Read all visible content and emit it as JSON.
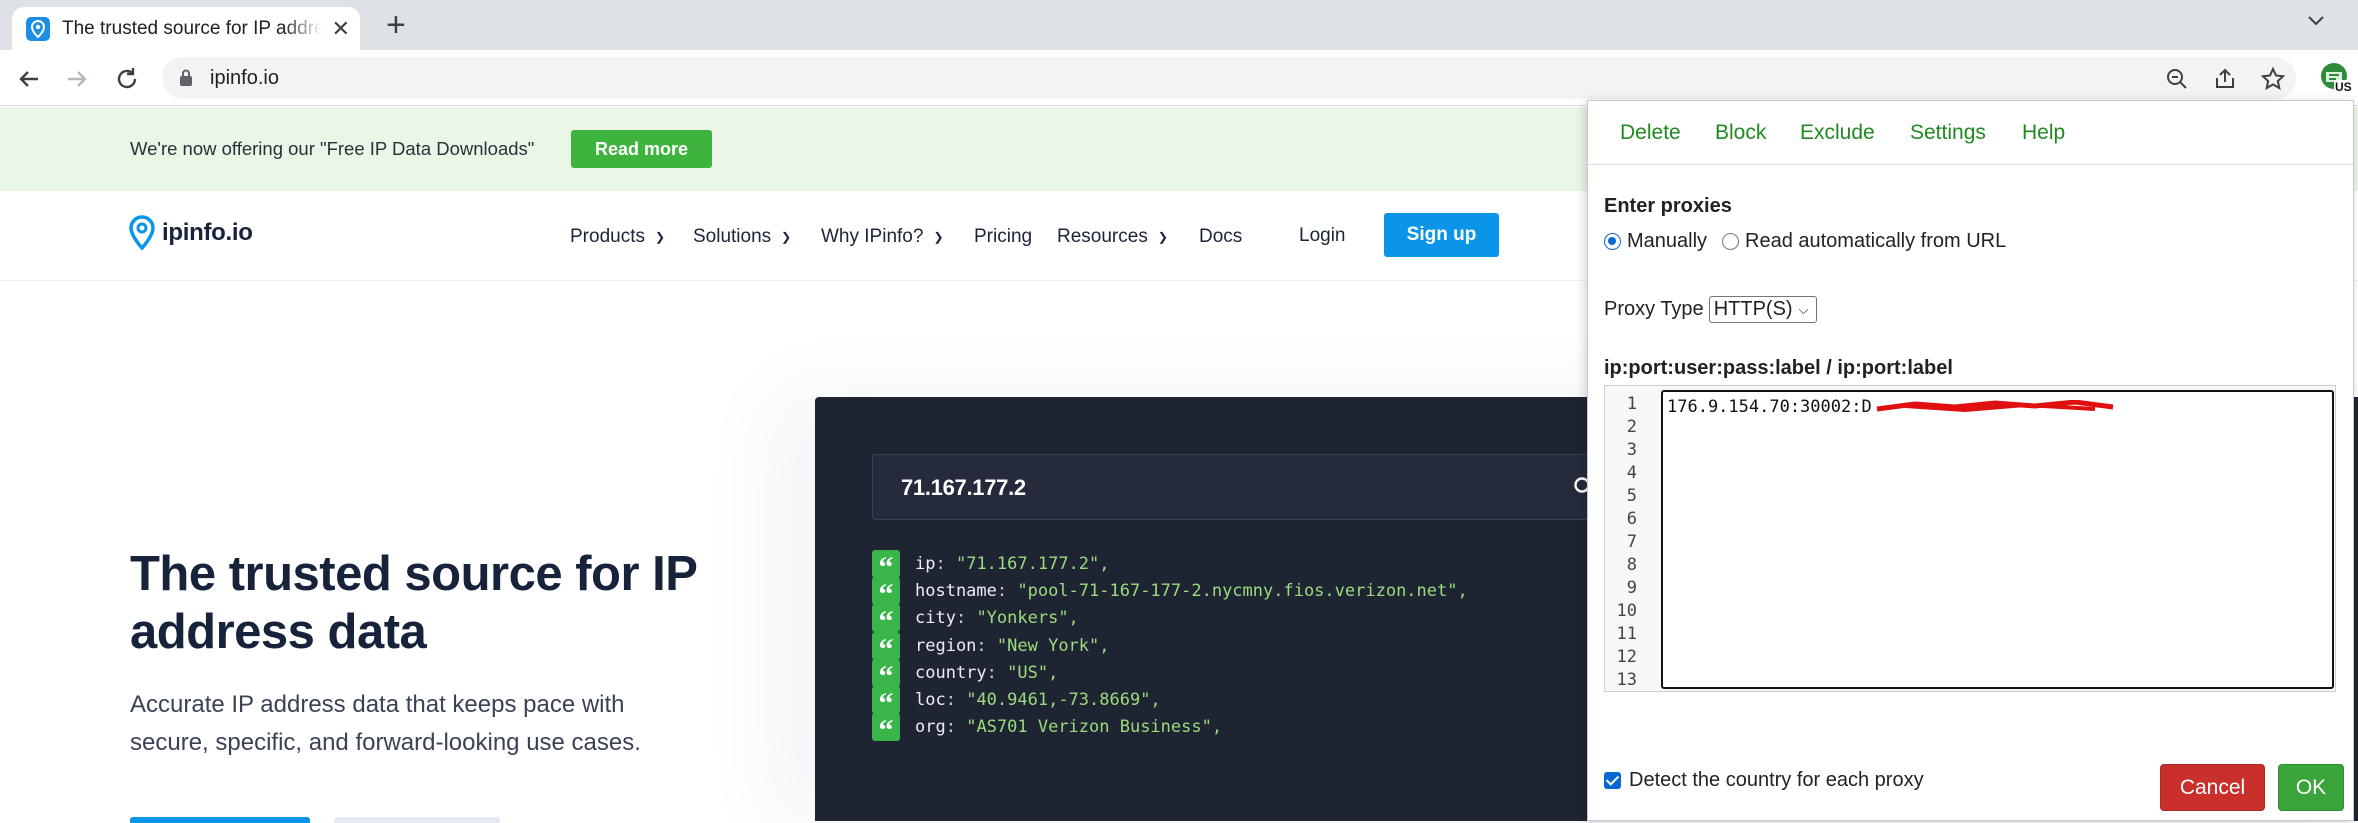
{
  "browser": {
    "tab_title": "The trusted source for IP address data",
    "tab_close": "✕",
    "new_tab": "+",
    "url": "ipinfo.io",
    "extension_badge": "US"
  },
  "banner": {
    "text": "We're now offering our \"Free IP Data Downloads\"",
    "button": "Read more"
  },
  "nav": {
    "logo": "ipinfo.io",
    "items": [
      {
        "label": "Products",
        "has_dropdown": true
      },
      {
        "label": "Solutions",
        "has_dropdown": true
      },
      {
        "label": "Why IPinfo?",
        "has_dropdown": true
      },
      {
        "label": "Pricing",
        "has_dropdown": false
      },
      {
        "label": "Resources",
        "has_dropdown": true
      },
      {
        "label": "Docs",
        "has_dropdown": false
      }
    ],
    "login": "Login",
    "signup": "Sign up"
  },
  "hero": {
    "title": "The trusted source for IP address data",
    "subtitle": "Accurate IP address data that keeps pace with secure, specific, and forward-looking use cases."
  },
  "lookup": {
    "ip": "71.167.177.2",
    "rows": [
      {
        "key": "ip",
        "value": "\"71.167.177.2\","
      },
      {
        "key": "hostname",
        "value": "\"pool-71-167-177-2.nycmny.fios.verizon.net\","
      },
      {
        "key": "city",
        "value": "\"Yonkers\","
      },
      {
        "key": "region",
        "value": "\"New York\","
      },
      {
        "key": "country",
        "value": "\"US\","
      },
      {
        "key": "loc",
        "value": "\"40.9461,-73.8669\","
      },
      {
        "key": "org",
        "value": "\"AS701 Verizon Business\","
      }
    ]
  },
  "popup": {
    "menu": [
      "Delete",
      "Block",
      "Exclude",
      "Settings",
      "Help"
    ],
    "enter_proxies": "Enter proxies",
    "radio_manual": "Manually",
    "radio_url": "Read automatically from URL",
    "proxy_type_label": "Proxy Type",
    "proxy_type_value": "HTTP(S)",
    "format_label": "ip:port:user:pass:label / ip:port:label",
    "line_numbers": [
      "1",
      "2",
      "3",
      "4",
      "5",
      "6",
      "7",
      "8",
      "9",
      "10",
      "11",
      "12",
      "13"
    ],
    "proxy_line": "176.9.154.70:30002:D",
    "detect_country": "Detect the country for each proxy",
    "cancel": "Cancel",
    "ok": "OK"
  },
  "colors": {
    "accent_blue": "#0b95e9",
    "banner_green": "#3eb33e",
    "popup_link_green": "#208a20",
    "cancel_red": "#c9302c",
    "ok_green": "#3aa33a",
    "code_bg": "#1f2433"
  }
}
